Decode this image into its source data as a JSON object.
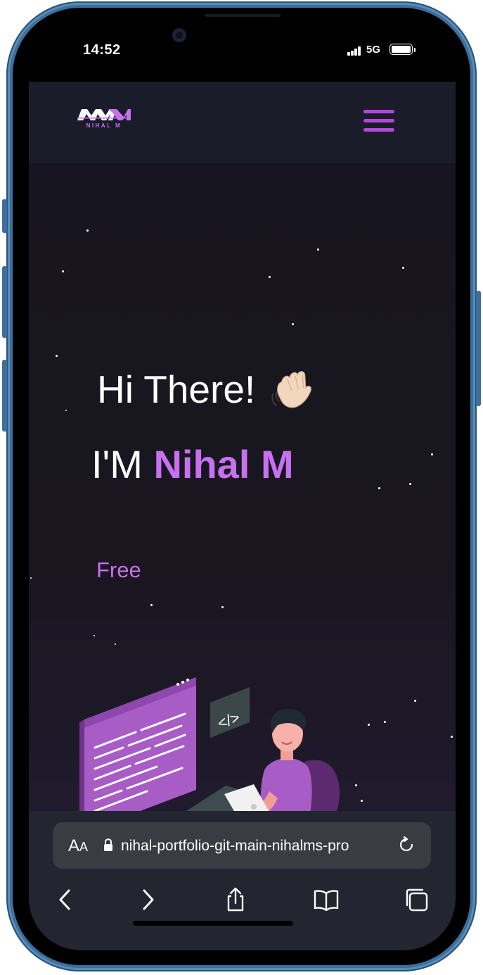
{
  "status_bar": {
    "time": "14:52",
    "network": "5G",
    "icons": [
      "signal-icon",
      "battery-icon"
    ]
  },
  "nav": {
    "logo_text": "NIHAL M",
    "menu_icon": "hamburger-menu-icon"
  },
  "hero": {
    "greeting": "Hi There!",
    "wave_icon": "waving-hand-emoji",
    "intro_prefix": "I'M",
    "name": "Nihal M",
    "typewriter_text": "Free",
    "illustration": "developer-at-laptop-illustration",
    "code_badge": "</>"
  },
  "safari": {
    "aa_big": "A",
    "aa_small": "A",
    "url": "nihal-portfolio-git-main-nihalms-pro",
    "toolbar": [
      "back-icon",
      "forward-icon",
      "share-icon",
      "bookmarks-icon",
      "tabs-icon"
    ]
  },
  "colors": {
    "accent": "#c770f0",
    "menu": "#b347d9",
    "navbar_bg": "#1a1d29",
    "page_bg": "#17151d",
    "safari_bar": "#232530",
    "frame": "#3d6f9c"
  }
}
